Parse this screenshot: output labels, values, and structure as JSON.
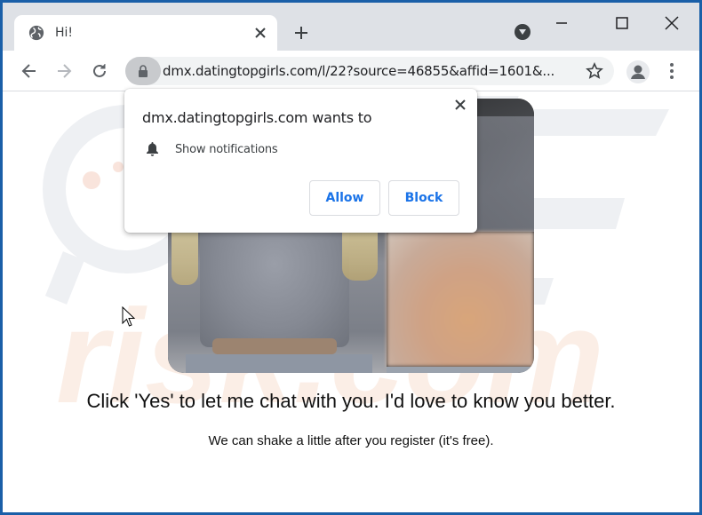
{
  "browser": {
    "tab": {
      "title": "Hi!",
      "icon": "globe-icon"
    },
    "new_tab_icon": "plus-icon",
    "media_icon": "media-control-icon",
    "window_controls": [
      "minimize-icon",
      "maximize-icon",
      "close-icon"
    ],
    "nav": {
      "back_icon": "back-arrow-icon",
      "forward_icon": "forward-arrow-icon",
      "reload_icon": "reload-icon"
    },
    "address_bar": {
      "security_icon": "lock-icon",
      "url": "dmx.datingtopgirls.com/l/22?source=46855&affid=1601&..."
    },
    "bookmark_icon": "star-icon",
    "profile_icon": "profile-avatar-icon",
    "menu_icon": "kebab-menu-icon"
  },
  "permission_popup": {
    "title": "dmx.datingtopgirls.com wants to",
    "permission": "Show notifications",
    "permission_icon": "bell-icon",
    "allow_label": "Allow",
    "block_label": "Block",
    "accent_color": "#1a73e8"
  },
  "page": {
    "headline": "Click 'Yes' to let me chat with you. I'd love to know you better.",
    "subline": "We can shake a little after you register (it's free).",
    "watermark_text": "risk.com",
    "watermark_color": "#f6d9c8"
  },
  "colors": {
    "window_border": "#1a5fa8",
    "tabbar_bg": "#dee1e6",
    "omnibox_bg": "#f1f3f4"
  }
}
